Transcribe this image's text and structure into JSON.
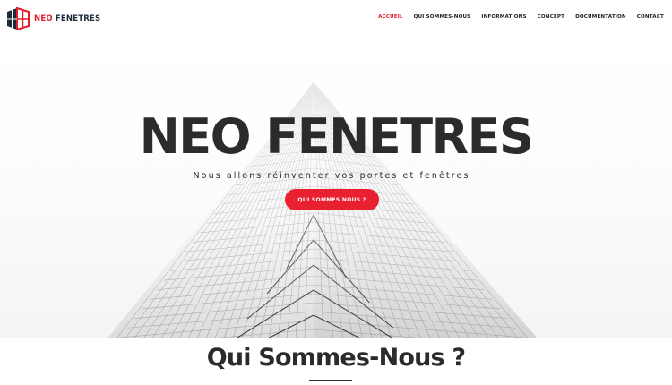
{
  "brand": {
    "name_prefix": "NEO",
    "name_suffix": "FENETRES",
    "accent_color": "#e31c2d",
    "dark_color": "#1d2a3a"
  },
  "nav": {
    "items": [
      {
        "label": "ACCUEIL",
        "active": true
      },
      {
        "label": "QUI SOMMES-NOUS",
        "active": false
      },
      {
        "label": "INFORMATIONS",
        "active": false
      },
      {
        "label": "CONCEPT",
        "active": false
      },
      {
        "label": "DOCUMENTATION",
        "active": false
      },
      {
        "label": "CONTACT",
        "active": false
      }
    ]
  },
  "hero": {
    "title": "NEO FENETRES",
    "subtitle": "Nous allons réinventer vos portes et fenêtres",
    "button_label": "QUI SOMMES NOUS ?",
    "background": "building-glass-facade"
  },
  "section": {
    "title": "Qui Sommes-Nous ?"
  }
}
